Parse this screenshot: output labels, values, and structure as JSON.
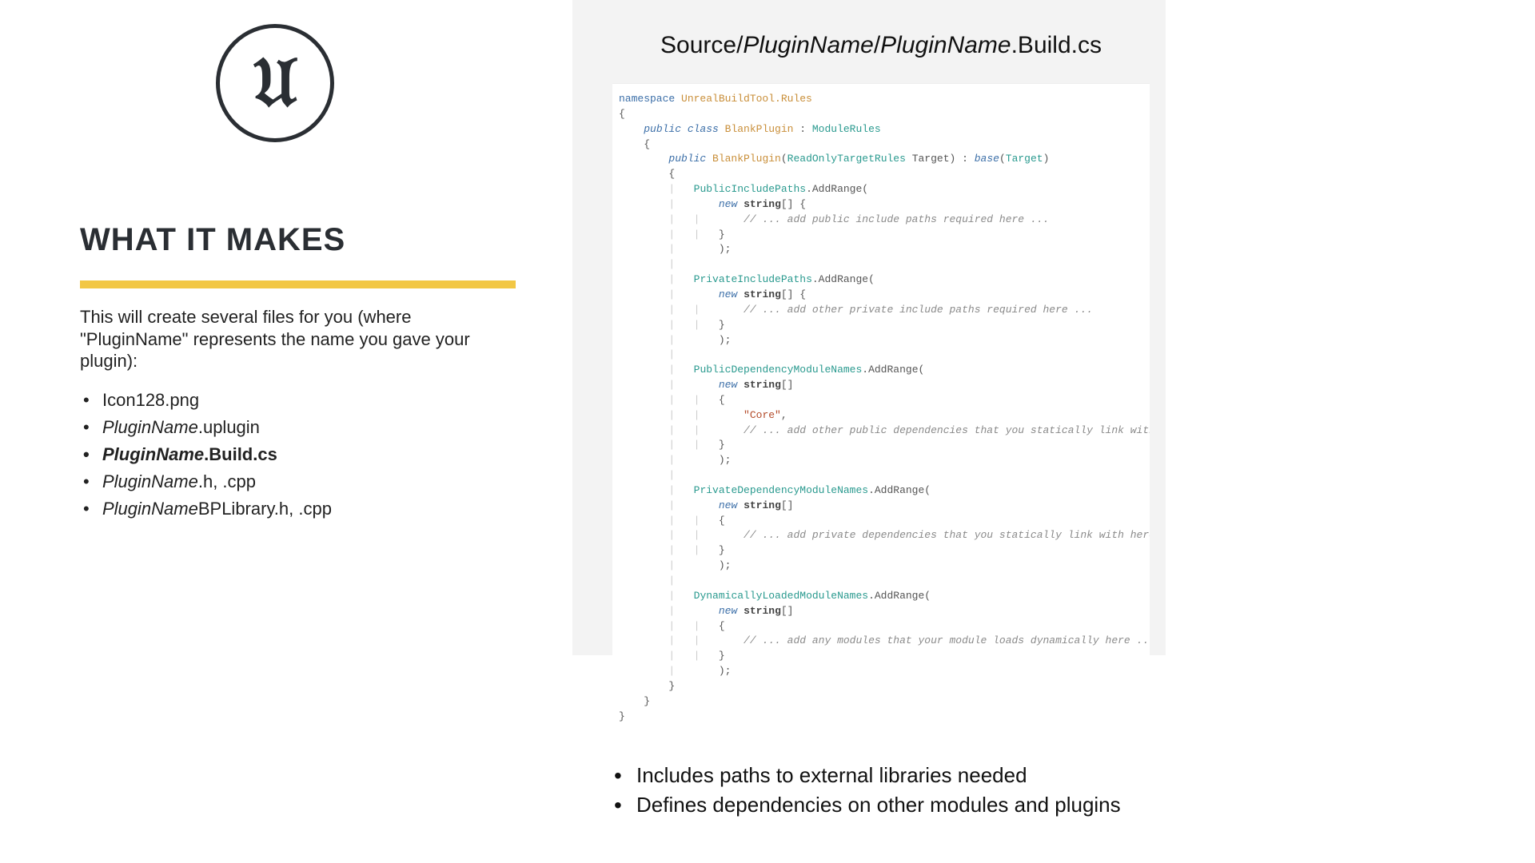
{
  "left": {
    "heading": "WHAT IT MAKES",
    "intro": "This will create several files for you (where \"PluginName\" represents the name you gave your plugin):",
    "files": {
      "f1": "Icon128.png",
      "f2_italic": "PluginName",
      "f2_rest": ".uplugin",
      "f3_italic": "PluginName",
      "f3_rest": ".Build.cs",
      "f4_italic": "PluginName",
      "f4_rest": ".h, .cpp",
      "f5_italic": "PluginName",
      "f5_rest": "BPLibrary.h, .cpp"
    }
  },
  "right": {
    "title_pre": "Source/",
    "title_it1": "PluginName",
    "title_mid": "/",
    "title_it2": "PluginName",
    "title_post": ".Build.cs",
    "bullets": {
      "b1": "Includes paths to external libraries needed",
      "b2": "Defines dependencies on other modules and plugins"
    },
    "code": {
      "l1a": "namespace ",
      "l1b": "UnrealBuildTool.Rules",
      "l3a": "public class ",
      "l3b": "BlankPlugin",
      "l3c": " : ",
      "l3d": "ModuleRules",
      "l5a": "public ",
      "l5b": "BlankPlugin",
      "l5c": "(",
      "l5d": "ReadOnlyTargetRules",
      "l5e": " Target) : ",
      "l5f": "base",
      "l5g": "(",
      "l5h": "Target",
      "l5i": ")",
      "pip": "PublicIncludePaths",
      "prip": "PrivateIncludePaths",
      "pdmn": "PublicDependencyModuleNames",
      "prdmn": "PrivateDependencyModuleNames",
      "dlmn": "DynamicallyLoadedModuleNames",
      "addr": ".AddRange(",
      "newstr": "new ",
      "strbr": "string",
      "arrbr": "[] {",
      "arr_open": "[]",
      "brace_open": "{",
      "brace_close": "}",
      "close_paren": ");",
      "core": "\"Core\"",
      "comma": ",",
      "c_pub_inc": "// ... add public include paths required here ...",
      "c_priv_inc": "// ... add other private include paths required here ...",
      "c_pub_dep": "// ... add other public dependencies that you statically link with here ...",
      "c_priv_dep": "// ... add private dependencies that you statically link with here ...",
      "c_dyn": "// ... add any modules that your module loads dynamically here ..."
    }
  }
}
